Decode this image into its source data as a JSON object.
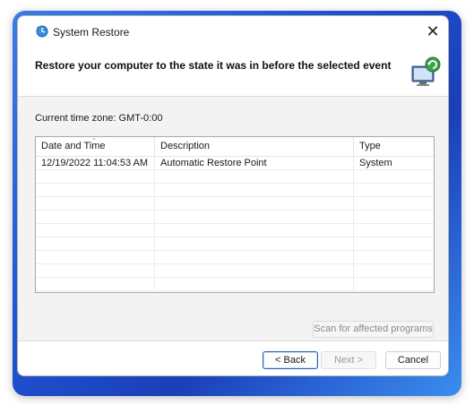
{
  "window": {
    "title": "System Restore",
    "close_glyph": "✕"
  },
  "header": {
    "title": "Restore your computer to the state it was in before the selected event"
  },
  "body": {
    "timezone": "Current time zone: GMT-0:00"
  },
  "table": {
    "columns": [
      "Date and Time",
      "Description",
      "Type"
    ],
    "sorted_column": "Date and Time",
    "rows": [
      [
        "12/19/2022 11:04:53 AM",
        "Automatic Restore Point",
        "System"
      ]
    ]
  },
  "buttons": {
    "scan": "Scan for affected programs",
    "back": "< Back",
    "next": "Next >",
    "cancel": "Cancel"
  },
  "icons": {
    "app": "system-restore-icon",
    "header": "restore-monitor-icon"
  },
  "colors": {
    "wallpaper": "#2156d6",
    "body_bg": "#f3f3f3",
    "default_button_border": "#2a5fb0"
  }
}
